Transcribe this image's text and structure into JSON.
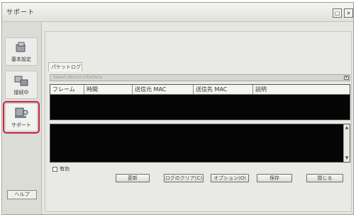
{
  "window": {
    "title": "サポート",
    "minimize_glyph": "▢",
    "close_glyph": "×"
  },
  "sidebar": {
    "items": [
      {
        "label": "基本設定",
        "icon": "settings-icon"
      },
      {
        "label": "接続中",
        "icon": "connection-icon"
      },
      {
        "label": "サポート",
        "icon": "support-icon",
        "selected": true
      }
    ],
    "bottom_button": "ヘルプ"
  },
  "main": {
    "tab_label": "パケットログ",
    "filter_placeholder": "Select device interface",
    "table": {
      "columns": [
        "フレーム",
        "時間",
        "送信元 MAC",
        "送信先 MAC",
        "説明"
      ]
    },
    "enable_label": "有効",
    "buttons": [
      "更新",
      "ログのクリア(C)",
      "オプション(O)",
      "保存",
      "閉じる"
    ]
  },
  "colors": {
    "highlight": "#c8233f",
    "log_background": "#050505"
  }
}
